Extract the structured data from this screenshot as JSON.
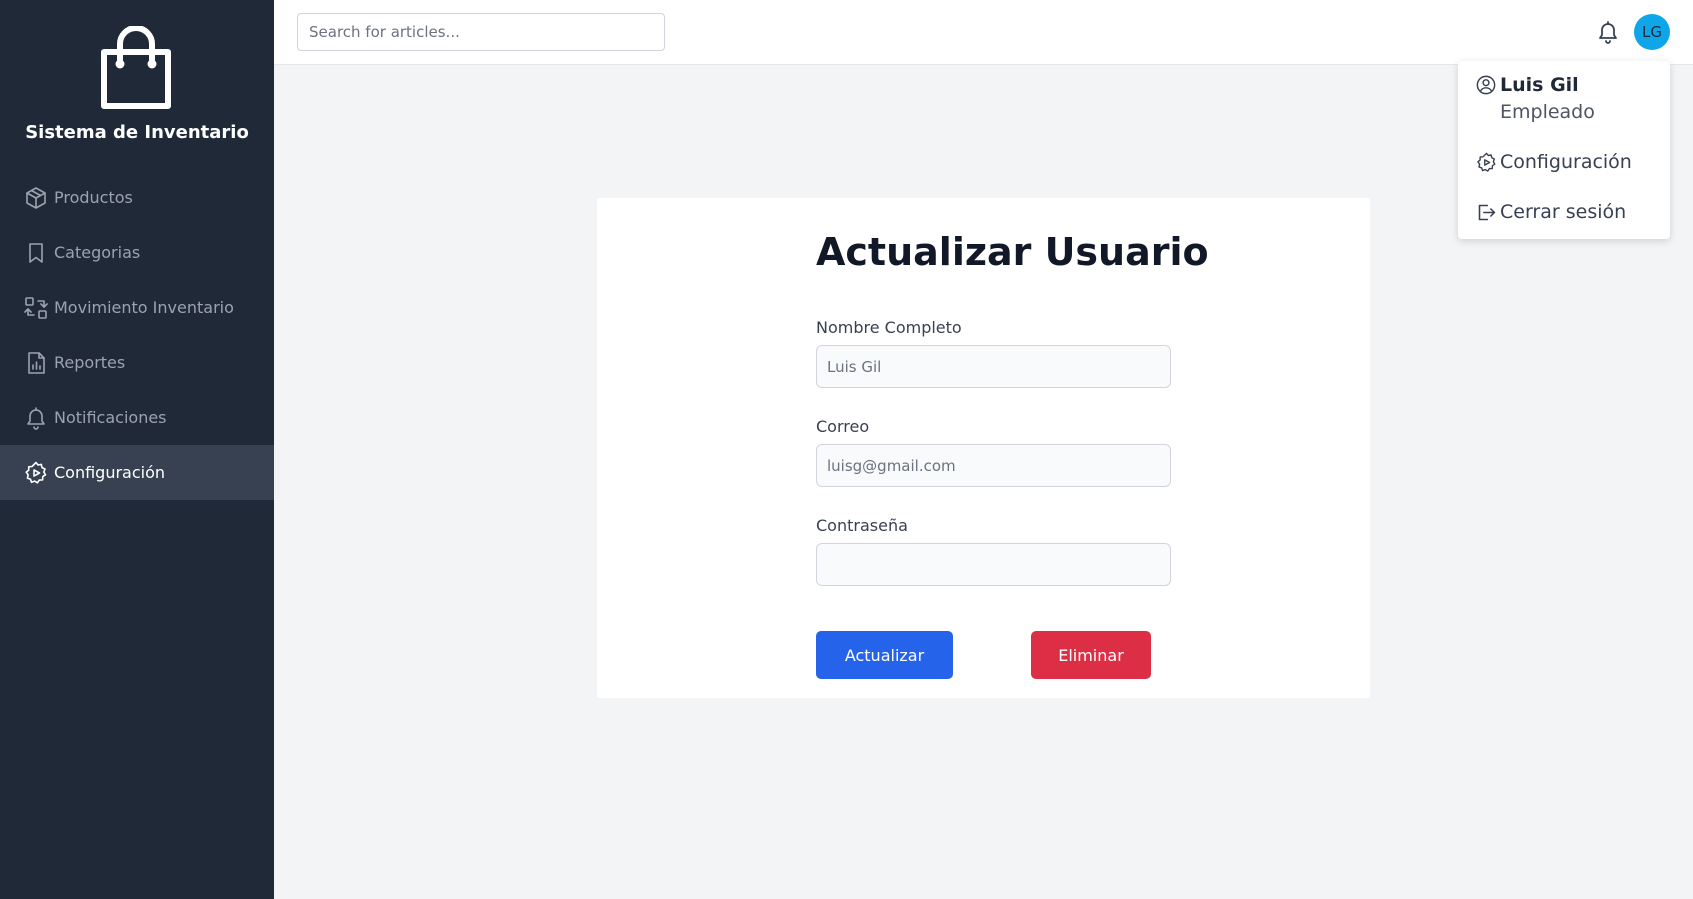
{
  "sidebar": {
    "brand_title": "Sistema de Inventario",
    "items": [
      {
        "label": "Productos",
        "icon": "cube-icon"
      },
      {
        "label": "Categorias",
        "icon": "bookmark-icon"
      },
      {
        "label": "Movimiento Inventario",
        "icon": "swap-icon"
      },
      {
        "label": "Reportes",
        "icon": "report-icon"
      },
      {
        "label": "Notificaciones",
        "icon": "bell-icon"
      },
      {
        "label": "Configuración",
        "icon": "gear-icon",
        "active": true
      }
    ]
  },
  "header": {
    "search_placeholder": "Search for articles...",
    "avatar_initials": "LG"
  },
  "user_menu": {
    "name": "Luis Gil",
    "role": "Empleado",
    "settings_label": "Configuración",
    "logout_label": "Cerrar sesión"
  },
  "form": {
    "title": "Actualizar Usuario",
    "name_label": "Nombre Completo",
    "name_placeholder": "Luis Gil",
    "email_label": "Correo",
    "email_placeholder": "luisg@gmail.com",
    "password_label": "Contraseña",
    "password_value": "",
    "update_button": "Actualizar",
    "delete_button": "Eliminar"
  },
  "colors": {
    "sidebar_bg": "#1f2937",
    "active_item_bg": "#374151",
    "avatar_bg": "#0ea5e9",
    "update_button": "#2563eb",
    "delete_button": "#dc2f45"
  }
}
